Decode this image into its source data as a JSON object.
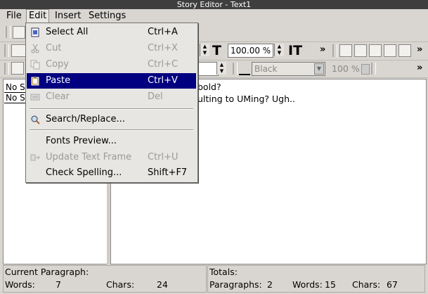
{
  "window": {
    "title": "Story Editor - Text1"
  },
  "menubar": {
    "file": "File",
    "edit": "Edit",
    "insert": "Insert",
    "settings": "Settings"
  },
  "toolbar2": {
    "font_size_value": "100.00 %"
  },
  "toolbar3": {
    "color_value": "Black",
    "shade_value": "100 %"
  },
  "styles": {
    "row1": "No S",
    "row2": "No S"
  },
  "editor": {
    "line1": "bold?",
    "line2": "ulting to UMing? Ugh.."
  },
  "status": {
    "current_paragraph_label": "Current Paragraph:",
    "words_label": "Words:",
    "words_value": "7",
    "chars_label": "Chars:",
    "chars_value": "24",
    "totals_label": "Totals:",
    "paragraphs_label": "Paragraphs:",
    "paragraphs_value": "2",
    "total_words_label": "Words:",
    "total_words_value": "15",
    "total_chars_label": "Chars:",
    "total_chars_value": "67"
  },
  "edit_menu": {
    "select_all": {
      "label": "Select All",
      "shortcut": "Ctrl+A"
    },
    "cut": {
      "label": "Cut",
      "shortcut": "Ctrl+X"
    },
    "copy": {
      "label": "Copy",
      "shortcut": "Ctrl+C"
    },
    "paste": {
      "label": "Paste",
      "shortcut": "Ctrl+V"
    },
    "clear": {
      "label": "Clear",
      "shortcut": "Del"
    },
    "search_replace": {
      "label": "Search/Replace..."
    },
    "fonts_preview": {
      "label": "Fonts Preview..."
    },
    "update_text_frame": {
      "label": "Update Text Frame",
      "shortcut": "Ctrl+U"
    },
    "check_spelling": {
      "label": "Check Spelling...",
      "shortcut": "Shift+F7"
    }
  },
  "colors": {
    "selection": "#000080",
    "titlebar": "#3e3e3e",
    "background": "#d9d6d1"
  },
  "icons": {
    "select_all": "select-all-icon",
    "cut": "scissors-icon",
    "copy": "copy-icon",
    "paste": "clipboard-icon",
    "clear": "eraser-icon",
    "search": "search-replace-icon",
    "update": "update-frame-icon"
  }
}
